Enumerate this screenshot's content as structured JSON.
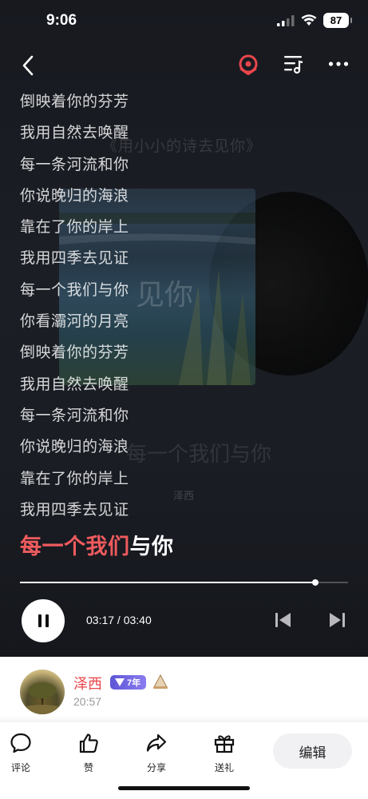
{
  "status_bar": {
    "time": "9:06",
    "battery": "87"
  },
  "background": {
    "album_title": "《用小小的诗去见你》",
    "cover_text": "见你",
    "echo_lyric": "每一个我们与你",
    "echo_artist": "泽西"
  },
  "lyrics": [
    "倒映着你的芬芳",
    "我用自然去唤醒",
    "每一条河流和你",
    "你说晚归的海浪",
    "靠在了你的岸上",
    "我用四季去见证",
    "每一个我们与你",
    "你看灞河的月亮",
    "倒映着你的芬芳",
    "我用自然去唤醒",
    "每一条河流和你",
    "你说晚归的海浪",
    "靠在了你的岸上",
    "我用四季去见证"
  ],
  "current_line": {
    "sung": "每一个我们",
    "unsung": "与你"
  },
  "player": {
    "progress": 0.9,
    "time_text": "03:17 / 03:40"
  },
  "user": {
    "name": "泽西",
    "vip_text": "7年",
    "post_time": "20:57"
  },
  "actions": [
    {
      "label": "评论",
      "icon": "comment-icon"
    },
    {
      "label": "赞",
      "icon": "thumbs-up-icon"
    },
    {
      "label": "分享",
      "icon": "share-icon"
    },
    {
      "label": "送礼",
      "icon": "gift-icon"
    }
  ],
  "edit_label": "编辑",
  "colors": {
    "accent": "#f05b5e",
    "name": "#e8464b",
    "vip": "#6a5fe0"
  }
}
